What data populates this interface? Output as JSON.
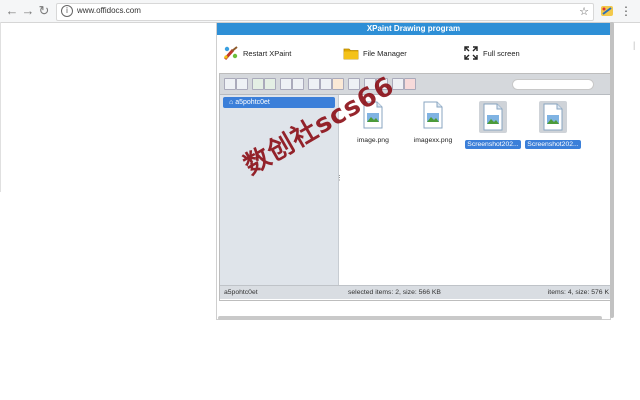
{
  "browser": {
    "url": "www.offidocs.com"
  },
  "app": {
    "title": "XPaint Drawing program",
    "toolbar": {
      "restart_label": "Restart XPaint",
      "file_manager_label": "File Manager",
      "fullscreen_label": "Full screen"
    }
  },
  "filemanager": {
    "tree_root": "a5pohtc0et",
    "files": [
      {
        "name": "image.png",
        "selected": false
      },
      {
        "name": "imagexx.png",
        "selected": false
      },
      {
        "name": "Screenshot202...",
        "selected": true
      },
      {
        "name": "Screenshot202...",
        "selected": true
      }
    ],
    "status": {
      "path": "a5pohtc0et",
      "selected": "selected items: 2, size: 566 KB",
      "items": "items: 4, size: 576 K"
    }
  },
  "watermark": "数创社scs66",
  "colors": {
    "title_bar": "#2e8fd6",
    "selection": "#3b7fd9",
    "watermark": "#8b0e16"
  }
}
